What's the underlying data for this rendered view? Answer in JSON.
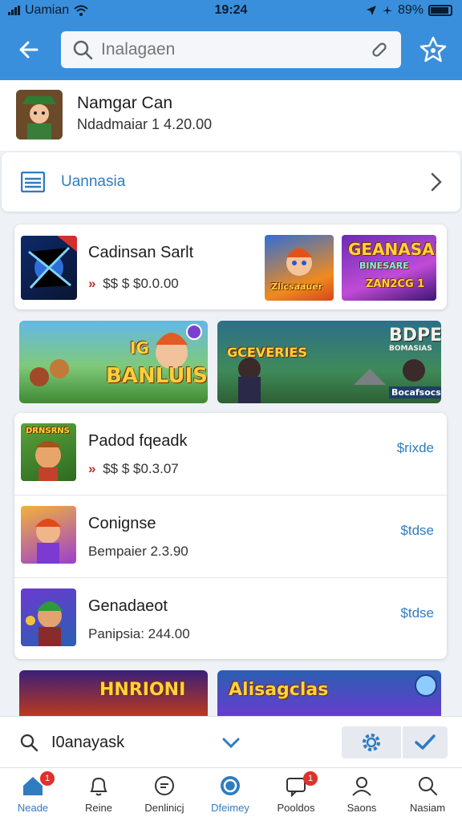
{
  "status_bar": {
    "carrier": "Uamian",
    "time": "19:24",
    "battery": "89%"
  },
  "header": {
    "search_placeholder": "Inalagaen"
  },
  "app_info": {
    "title": "Namgar Can",
    "subtitle": "Ndadmaiar 1 4.20.00"
  },
  "category": {
    "label": "Uannasia"
  },
  "featured": {
    "title": "Cadinsan Sarlt",
    "price_prefix": "»",
    "price": "$$ $ $0.0.00",
    "thumb2_text": "Zllcsaauer",
    "thumb3_text_top": "GEANASAI",
    "thumb3_text_mid": "BINESARE",
    "thumb3_text_bot": "ZAN2CG 1"
  },
  "banners": [
    {
      "text": "BANLUIS",
      "tag": "IG"
    },
    {
      "top_text": "BDPE",
      "mid_text": "GCEVERIES",
      "small": "BOMASIAS",
      "corner": "Bocafsocs"
    }
  ],
  "list_items": [
    {
      "title": "Padod fqeadk",
      "price_prefix": "»",
      "price": "$$ $ $0.3.07",
      "action": "$rixde",
      "thumb_text": "DRNSRNS"
    },
    {
      "title": "Conignse",
      "price": "Bempaier 2.3.90",
      "action": "$tdse"
    },
    {
      "title": "Genadaeot",
      "price": "Panipsia: 244.00",
      "action": "$tdse"
    }
  ],
  "bottom_banners": [
    {
      "text": "HNRIONI"
    },
    {
      "text": "Alisagclas"
    }
  ],
  "bottom_search": {
    "query": "I0anayask"
  },
  "tabs": [
    {
      "label": "Neade",
      "icon": "home-icon",
      "badge": "1"
    },
    {
      "label": "Reine",
      "icon": "bell-icon"
    },
    {
      "label": "Denlinicj",
      "icon": "chat-icon"
    },
    {
      "label": "Dfeimey",
      "icon": "globe-icon"
    },
    {
      "label": "Pooldos",
      "icon": "message-icon",
      "badge": "1"
    },
    {
      "label": "Saons",
      "icon": "user-icon"
    },
    {
      "label": "Nasiam",
      "icon": "search-icon"
    }
  ],
  "colors": {
    "accent": "#3a8fdc",
    "link": "#2f7cc1",
    "badge": "#e0302b"
  }
}
